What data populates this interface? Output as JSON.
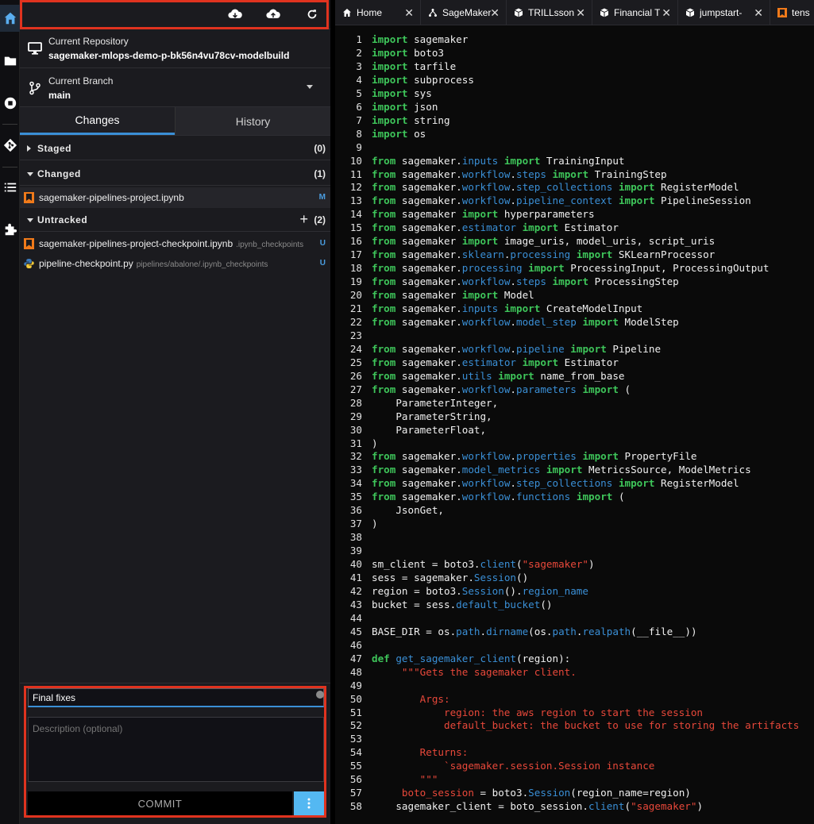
{
  "git_panel": {
    "repository_label": "Current Repository",
    "repository_name": "sagemaker-mlops-demo-p-bk56n4vu78cv-modelbuild",
    "branch_label": "Current Branch",
    "branch_name": "main",
    "tabs": [
      {
        "label": "Changes",
        "active": true
      },
      {
        "label": "History",
        "active": false
      }
    ],
    "sections": [
      {
        "name": "Staged",
        "count": "(0)",
        "expanded": false
      },
      {
        "name": "Changed",
        "count": "(1)",
        "expanded": true
      },
      {
        "name": "Untracked",
        "count": "(2)",
        "expanded": true
      }
    ],
    "changed_files": [
      {
        "name": "sagemaker-pipelines-project.ipynb",
        "path": "",
        "status": "M",
        "icon": "notebook-icon"
      }
    ],
    "untracked_files": [
      {
        "name": "sagemaker-pipelines-project-checkpoint.ipynb",
        "path": ".ipynb_checkpoints",
        "status": "U",
        "icon": "notebook-icon"
      },
      {
        "name": "pipeline-checkpoint.py",
        "path": "pipelines/abalone/.ipynb_checkpoints",
        "status": "U",
        "icon": "python-icon"
      }
    ],
    "commit": {
      "summary_value": "Final fixes",
      "description_placeholder": "Description (optional)",
      "commit_label": "COMMIT"
    }
  },
  "editor_tabs": [
    {
      "label": "Home",
      "icon": "home-icon"
    },
    {
      "label": "SageMaker",
      "icon": "pipeline-icon"
    },
    {
      "label": "TRILLsson",
      "icon": "cube-icon"
    },
    {
      "label": "Financial T",
      "icon": "cube-icon"
    },
    {
      "label": "jumpstart-",
      "icon": "cube-icon"
    },
    {
      "label": "tens",
      "icon": "notebook-icon"
    }
  ],
  "code_lines": [
    [
      [
        "kw",
        "import"
      ],
      [
        "t",
        " sagemaker"
      ]
    ],
    [
      [
        "kw",
        "import"
      ],
      [
        "t",
        " boto3"
      ]
    ],
    [
      [
        "kw",
        "import"
      ],
      [
        "t",
        " tarfile"
      ]
    ],
    [
      [
        "kw",
        "import"
      ],
      [
        "t",
        " subprocess"
      ]
    ],
    [
      [
        "kw",
        "import"
      ],
      [
        "t",
        " sys"
      ]
    ],
    [
      [
        "kw",
        "import"
      ],
      [
        "t",
        " json"
      ]
    ],
    [
      [
        "kw",
        "import"
      ],
      [
        "t",
        " string"
      ]
    ],
    [
      [
        "kw",
        "import"
      ],
      [
        "t",
        " os"
      ]
    ],
    [],
    [
      [
        "kw",
        "from"
      ],
      [
        "t",
        " sagemaker."
      ],
      [
        "at",
        "inputs"
      ],
      [
        "t",
        " "
      ],
      [
        "kw",
        "import"
      ],
      [
        "t",
        " TrainingInput"
      ]
    ],
    [
      [
        "kw",
        "from"
      ],
      [
        "t",
        " sagemaker."
      ],
      [
        "at",
        "workflow"
      ],
      [
        "t",
        "."
      ],
      [
        "at",
        "steps"
      ],
      [
        "t",
        " "
      ],
      [
        "kw",
        "import"
      ],
      [
        "t",
        " TrainingStep"
      ]
    ],
    [
      [
        "kw",
        "from"
      ],
      [
        "t",
        " sagemaker."
      ],
      [
        "at",
        "workflow"
      ],
      [
        "t",
        "."
      ],
      [
        "at",
        "step_collections"
      ],
      [
        "t",
        " "
      ],
      [
        "kw",
        "import"
      ],
      [
        "t",
        " RegisterModel"
      ]
    ],
    [
      [
        "kw",
        "from"
      ],
      [
        "t",
        " sagemaker."
      ],
      [
        "at",
        "workflow"
      ],
      [
        "t",
        "."
      ],
      [
        "at",
        "pipeline_context"
      ],
      [
        "t",
        " "
      ],
      [
        "kw",
        "import"
      ],
      [
        "t",
        " PipelineSession"
      ]
    ],
    [
      [
        "kw",
        "from"
      ],
      [
        "t",
        " sagemaker "
      ],
      [
        "kw",
        "import"
      ],
      [
        "t",
        " hyperparameters"
      ]
    ],
    [
      [
        "kw",
        "from"
      ],
      [
        "t",
        " sagemaker."
      ],
      [
        "at",
        "estimator"
      ],
      [
        "t",
        " "
      ],
      [
        "kw",
        "import"
      ],
      [
        "t",
        " Estimator"
      ]
    ],
    [
      [
        "kw",
        "from"
      ],
      [
        "t",
        " sagemaker "
      ],
      [
        "kw",
        "import"
      ],
      [
        "t",
        " image_uris, model_uris, script_uris"
      ]
    ],
    [
      [
        "kw",
        "from"
      ],
      [
        "t",
        " sagemaker."
      ],
      [
        "at",
        "sklearn"
      ],
      [
        "t",
        "."
      ],
      [
        "at",
        "processing"
      ],
      [
        "t",
        " "
      ],
      [
        "kw",
        "import"
      ],
      [
        "t",
        " SKLearnProcessor"
      ]
    ],
    [
      [
        "kw",
        "from"
      ],
      [
        "t",
        " sagemaker."
      ],
      [
        "at",
        "processing"
      ],
      [
        "t",
        " "
      ],
      [
        "kw",
        "import"
      ],
      [
        "t",
        " ProcessingInput, ProcessingOutput"
      ]
    ],
    [
      [
        "kw",
        "from"
      ],
      [
        "t",
        " sagemaker."
      ],
      [
        "at",
        "workflow"
      ],
      [
        "t",
        "."
      ],
      [
        "at",
        "steps"
      ],
      [
        "t",
        " "
      ],
      [
        "kw",
        "import"
      ],
      [
        "t",
        " ProcessingStep"
      ]
    ],
    [
      [
        "kw",
        "from"
      ],
      [
        "t",
        " sagemaker "
      ],
      [
        "kw",
        "import"
      ],
      [
        "t",
        " Model"
      ]
    ],
    [
      [
        "kw",
        "from"
      ],
      [
        "t",
        " sagemaker."
      ],
      [
        "at",
        "inputs"
      ],
      [
        "t",
        " "
      ],
      [
        "kw",
        "import"
      ],
      [
        "t",
        " CreateModelInput"
      ]
    ],
    [
      [
        "kw",
        "from"
      ],
      [
        "t",
        " sagemaker."
      ],
      [
        "at",
        "workflow"
      ],
      [
        "t",
        "."
      ],
      [
        "at",
        "model_step"
      ],
      [
        "t",
        " "
      ],
      [
        "kw",
        "import"
      ],
      [
        "t",
        " ModelStep"
      ]
    ],
    [],
    [
      [
        "kw",
        "from"
      ],
      [
        "t",
        " sagemaker."
      ],
      [
        "at",
        "workflow"
      ],
      [
        "t",
        "."
      ],
      [
        "at",
        "pipeline"
      ],
      [
        "t",
        " "
      ],
      [
        "kw",
        "import"
      ],
      [
        "t",
        " Pipeline"
      ]
    ],
    [
      [
        "kw",
        "from"
      ],
      [
        "t",
        " sagemaker."
      ],
      [
        "at",
        "estimator"
      ],
      [
        "t",
        " "
      ],
      [
        "kw",
        "import"
      ],
      [
        "t",
        " Estimator"
      ]
    ],
    [
      [
        "kw",
        "from"
      ],
      [
        "t",
        " sagemaker."
      ],
      [
        "at",
        "utils"
      ],
      [
        "t",
        " "
      ],
      [
        "kw",
        "import"
      ],
      [
        "t",
        " name_from_base"
      ]
    ],
    [
      [
        "kw",
        "from"
      ],
      [
        "t",
        " sagemaker."
      ],
      [
        "at",
        "workflow"
      ],
      [
        "t",
        "."
      ],
      [
        "at",
        "parameters"
      ],
      [
        "t",
        " "
      ],
      [
        "kw",
        "import"
      ],
      [
        "t",
        " ("
      ]
    ],
    [
      [
        "t",
        "    ParameterInteger,"
      ]
    ],
    [
      [
        "t",
        "    ParameterString,"
      ]
    ],
    [
      [
        "t",
        "    ParameterFloat,"
      ]
    ],
    [
      [
        "t",
        ")"
      ]
    ],
    [
      [
        "kw",
        "from"
      ],
      [
        "t",
        " sagemaker."
      ],
      [
        "at",
        "workflow"
      ],
      [
        "t",
        "."
      ],
      [
        "at",
        "properties"
      ],
      [
        "t",
        " "
      ],
      [
        "kw",
        "import"
      ],
      [
        "t",
        " PropertyFile"
      ]
    ],
    [
      [
        "kw",
        "from"
      ],
      [
        "t",
        " sagemaker."
      ],
      [
        "at",
        "model_metrics"
      ],
      [
        "t",
        " "
      ],
      [
        "kw",
        "import"
      ],
      [
        "t",
        " MetricsSource, ModelMetrics"
      ]
    ],
    [
      [
        "kw",
        "from"
      ],
      [
        "t",
        " sagemaker."
      ],
      [
        "at",
        "workflow"
      ],
      [
        "t",
        "."
      ],
      [
        "at",
        "step_collections"
      ],
      [
        "t",
        " "
      ],
      [
        "kw",
        "import"
      ],
      [
        "t",
        " RegisterModel"
      ]
    ],
    [
      [
        "kw",
        "from"
      ],
      [
        "t",
        " sagemaker."
      ],
      [
        "at",
        "workflow"
      ],
      [
        "t",
        "."
      ],
      [
        "at",
        "functions"
      ],
      [
        "t",
        " "
      ],
      [
        "kw",
        "import"
      ],
      [
        "t",
        " ("
      ]
    ],
    [
      [
        "t",
        "    JsonGet,"
      ]
    ],
    [
      [
        "t",
        ")"
      ]
    ],
    [],
    [],
    [
      [
        "t",
        "sm_client = boto3."
      ],
      [
        "at",
        "client"
      ],
      [
        "t",
        "("
      ],
      [
        "st",
        "\"sagemaker\""
      ],
      [
        "t",
        ")"
      ]
    ],
    [
      [
        "t",
        "sess = sagemaker."
      ],
      [
        "at",
        "Session"
      ],
      [
        "t",
        "()"
      ]
    ],
    [
      [
        "t",
        "region = boto3."
      ],
      [
        "at",
        "Session"
      ],
      [
        "t",
        "()."
      ],
      [
        "at",
        "region_name"
      ]
    ],
    [
      [
        "t",
        "bucket = sess."
      ],
      [
        "at",
        "default_bucket"
      ],
      [
        "t",
        "()"
      ]
    ],
    [],
    [
      [
        "t",
        "BASE_DIR = os."
      ],
      [
        "at",
        "path"
      ],
      [
        "t",
        "."
      ],
      [
        "at",
        "dirname"
      ],
      [
        "t",
        "(os."
      ],
      [
        "at",
        "path"
      ],
      [
        "t",
        "."
      ],
      [
        "at",
        "realpath"
      ],
      [
        "t",
        "(__file__))"
      ]
    ],
    [],
    [
      [
        "kw",
        "def"
      ],
      [
        "t",
        " "
      ],
      [
        "at",
        "get_sagemaker_client"
      ],
      [
        "t",
        "(region):"
      ]
    ],
    [
      [
        "st",
        "     \"\"\"Gets the sagemaker client."
      ]
    ],
    [],
    [
      [
        "st",
        "        Args:"
      ]
    ],
    [
      [
        "st",
        "            region: the aws region to start the session"
      ]
    ],
    [
      [
        "st",
        "            default_bucket: the bucket to use for storing the artifacts"
      ]
    ],
    [],
    [
      [
        "st",
        "        Returns:"
      ]
    ],
    [
      [
        "st",
        "            `sagemaker.session.Session instance"
      ]
    ],
    [
      [
        "st",
        "        \"\"\""
      ]
    ],
    [
      [
        "st",
        "     boto_session"
      ],
      [
        "t",
        " = boto3."
      ],
      [
        "at",
        "Session"
      ],
      [
        "t",
        "(region_name=region)"
      ]
    ],
    [
      [
        "t",
        "    sagemaker_client = boto_session."
      ],
      [
        "at",
        "client"
      ],
      [
        "t",
        "("
      ],
      [
        "st",
        "\"sagemaker\""
      ],
      [
        "t",
        ")"
      ]
    ]
  ]
}
